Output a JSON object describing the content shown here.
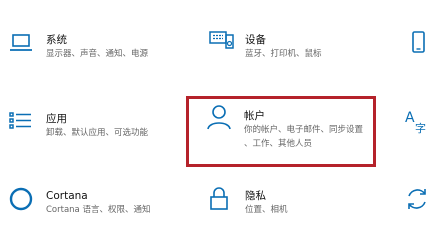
{
  "accent_color": "#0a6eb4",
  "highlight_color": "#b5222a",
  "tiles": [
    {
      "id": "system",
      "icon": "laptop-icon",
      "title": "系统",
      "desc": [
        "显示器、声音、通知、电源"
      ]
    },
    {
      "id": "devices",
      "icon": "keyboard-speaker-icon",
      "title": "设备",
      "desc": [
        "蓝牙、打印机、鼠标"
      ]
    },
    {
      "id": "phone",
      "icon": "phone-icon",
      "title": "",
      "desc": []
    },
    {
      "id": "apps",
      "icon": "apps-list-icon",
      "title": "应用",
      "desc": [
        "卸载、默认应用、可选功能"
      ]
    },
    {
      "id": "accounts",
      "icon": "person-icon",
      "title": "帐户",
      "desc": [
        "你的帐户、电子邮件、同步设置",
        "、工作、其他人员"
      ]
    },
    {
      "id": "time-language",
      "icon": "language-icon",
      "title": "",
      "desc": []
    },
    {
      "id": "cortana",
      "icon": "cortana-icon",
      "title": "Cortana",
      "desc": [
        "Cortana 语言、权限、通知"
      ]
    },
    {
      "id": "privacy",
      "icon": "lock-icon",
      "title": "隐私",
      "desc": [
        "位置、相机"
      ]
    },
    {
      "id": "update",
      "icon": "refresh-icon",
      "title": "",
      "desc": []
    }
  ]
}
